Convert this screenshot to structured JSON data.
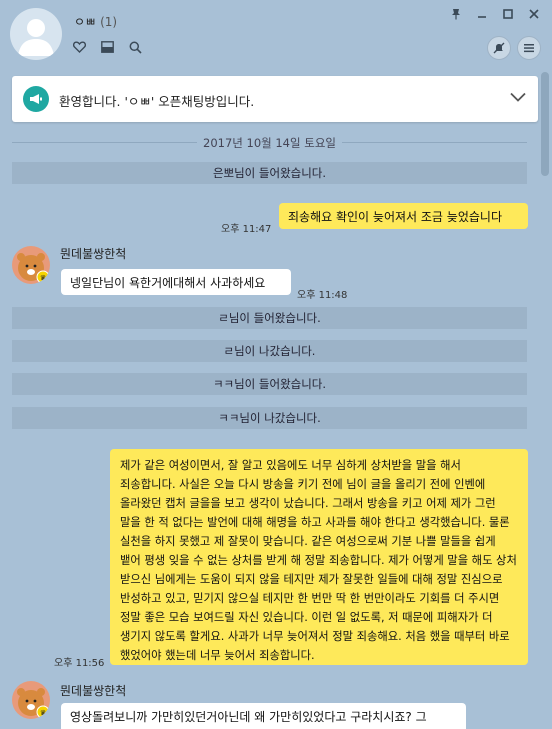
{
  "window": {
    "title": "ㅇㅃ",
    "member_count": "(1)"
  },
  "notice": {
    "text": "환영합니다. 'ㅇㅃ' 오픈채팅방입니다."
  },
  "chat": {
    "date_divider": "2017년 10월 14일 토요일",
    "system": [
      "은뽀님이 들어왔습니다.",
      "ㄹ님이 들어왔습니다.",
      "ㄹ님이 나갔습니다.",
      "ㅋㅋ님이 들어왔습니다.",
      "ㅋㅋ님이 나갔습니다."
    ],
    "messages": [
      {
        "from": "me",
        "text": "죄송해요 확인이 늦어져서 조금 늦었습니다",
        "time": "오후 11:47"
      },
      {
        "from": "other",
        "sender": "뭔데불쌍한척",
        "text": "넹일단님이 욕한거에대해서 사과하세요",
        "time": "오후 11:48"
      },
      {
        "from": "me",
        "text": "제가 같은 여성이면서, 잘 알고 있음에도 너무 심하게 상처받을 말을 해서 죄송합니다. 사실은 오늘 다시 방송을 키기 전에 님이 글을 올리기 전에 인벤에 올라왔던 캡처 글을을 보고 생각이 났습니다. 그래서 방송을 키고 어제 제가 그런 말을 한 적 없다는 발언에 대해 해명을 하고 사과를 해야 한다고 생각했습니다. 물론 실천을 하지 못했고 제 잘못이 맞습니다. 같은 여성으로써 기분 나쁠 말들을 쉽게 뱉어 평생 잊을 수 없는 상처를 받게 해 정말 죄송합니다. 제가 어떻게 말을 해도 상처 받으신 님에게는 도움이 되지 않을 테지만 제가 잘못한 일들에 대해 정말 진심으로 반성하고 있고, 믿기지 않으실 테지만 한 번만 딱 한 번만이라도 기회를 더 주시면 정말 좋은 모습 보여드릴 자신 있습니다. 이런 일 없도록, 저 때문에 피해자가 더 생기지 않도록 할게요. 사과가 너무 늦어져서 정말 죄송해요. 처음 했을 때부터 바로 했었어야 했는데 너무 늦어서 죄송합니다.",
        "time": "오후 11:56"
      },
      {
        "from": "other",
        "sender": "뭔데불쌍한척",
        "text": "영상돌려보니까 가만히있던거아닌데 왜 가만히있었다고 구라치시죠? 그",
        "time": ""
      }
    ]
  },
  "colors": {
    "background": "#a8c0d6",
    "my_bubble": "#fee95a",
    "other_bubble": "#ffffff",
    "system_bar": "#9cb3c8",
    "notice_accent": "#1fa8a2"
  }
}
